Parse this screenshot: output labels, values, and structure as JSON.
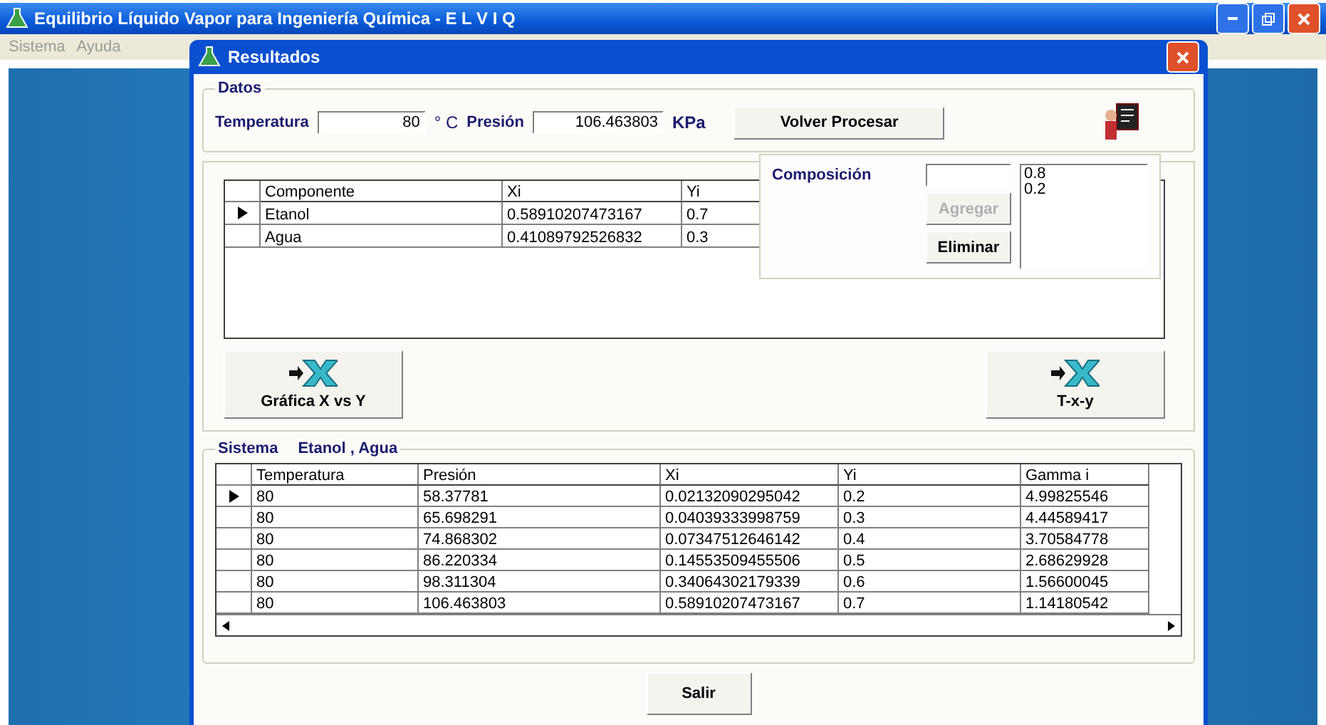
{
  "main_window": {
    "title": "Equilibrio Líquido Vapor para Ingeniería Química - E L V I Q",
    "menu": [
      "Sistema",
      "Ayuda"
    ]
  },
  "dialog": {
    "title": "Resultados"
  },
  "datos": {
    "legend": "Datos",
    "temperature_label": "Temperatura",
    "temperature_value": "80",
    "temperature_unit": "° C",
    "pressure_label": "Presión",
    "pressure_value": "106.463803",
    "pressure_unit": "KPa",
    "button": "Volver Procesar"
  },
  "composition_grid": {
    "columns": [
      "Componente",
      "Xi",
      "Yi"
    ],
    "rows": [
      {
        "selected": true,
        "cells": [
          "Etanol",
          "0.58910207473167",
          "0.7"
        ]
      },
      {
        "selected": false,
        "cells": [
          "Agua",
          "0.41089792526832",
          "0.3"
        ]
      }
    ]
  },
  "composicion": {
    "label": "Composición",
    "buttons": [
      {
        "label": "Agregar",
        "disabled": true
      },
      {
        "label": "Eliminar",
        "disabled": false
      }
    ],
    "list": [
      "0.8",
      "0.2"
    ]
  },
  "chart_buttons": [
    "Gráfica X vs Y",
    "T-x-y"
  ],
  "sistema": {
    "legend": "Sistema",
    "components": "Etanol ,  Agua",
    "columns": [
      "Temperatura",
      "Presión",
      "Xi",
      "Yi",
      "Gamma i"
    ],
    "rows": [
      {
        "selected": true,
        "cells": [
          "80",
          "58.37781",
          "0.02132090295042",
          "0.2",
          "4.99825546"
        ]
      },
      {
        "selected": false,
        "cells": [
          "80",
          "65.698291",
          "0.04039333998759",
          "0.3",
          "4.44589417"
        ]
      },
      {
        "selected": false,
        "cells": [
          "80",
          "74.868302",
          "0.07347512646142",
          "0.4",
          "3.70584778"
        ]
      },
      {
        "selected": false,
        "cells": [
          "80",
          "86.220334",
          "0.14553509455506",
          "0.5",
          "2.68629928"
        ]
      },
      {
        "selected": false,
        "cells": [
          "80",
          "98.311304",
          "0.34064302179339",
          "0.6",
          "1.56600045"
        ]
      },
      {
        "selected": false,
        "cells": [
          "80",
          "106.463803",
          "0.58910207473167",
          "0.7",
          "1.14180542"
        ]
      }
    ]
  },
  "exit_button": "Salir"
}
